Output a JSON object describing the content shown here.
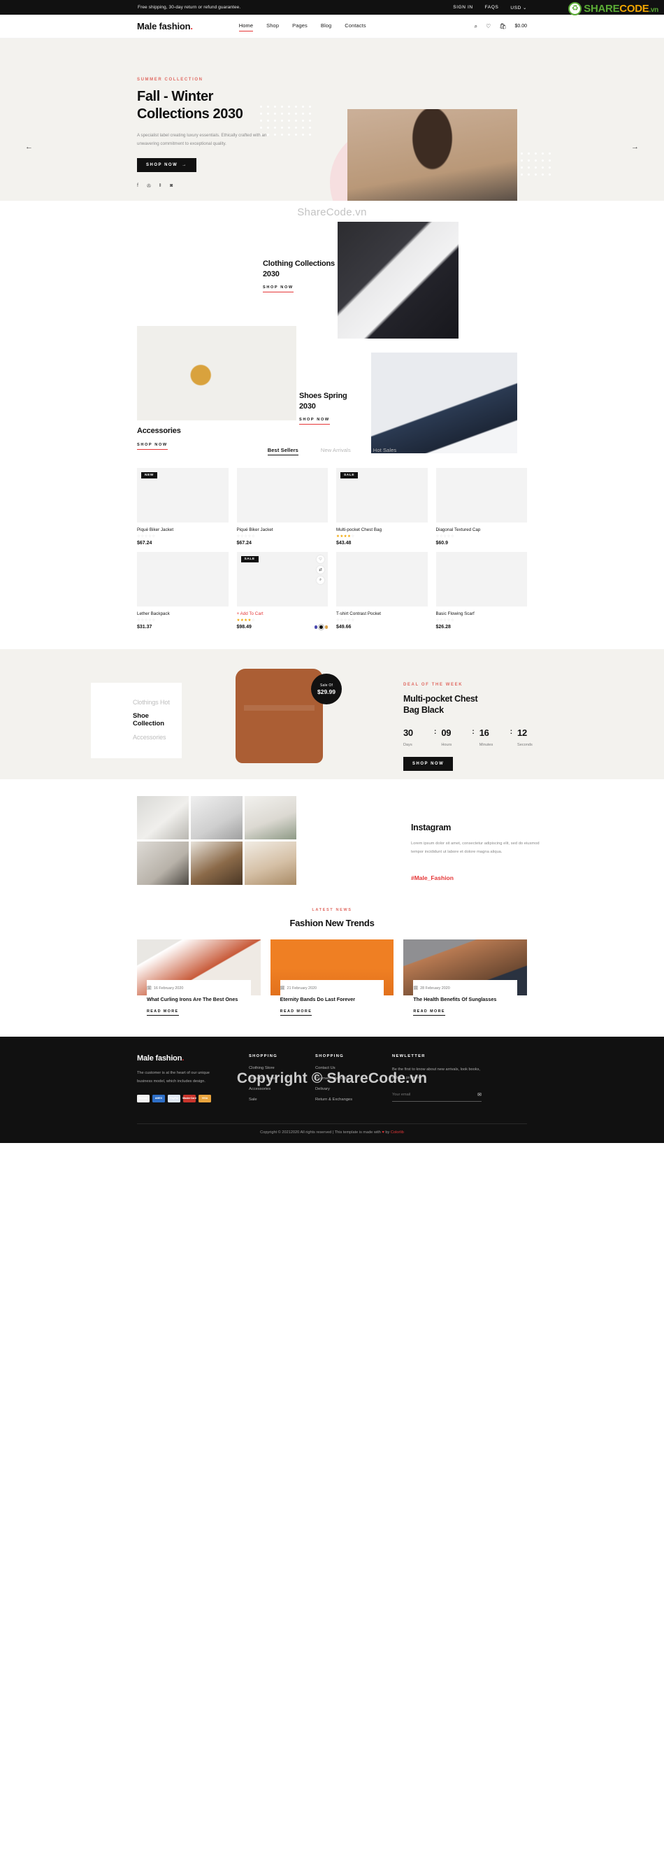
{
  "watermark": {
    "logo_share": "SHARE",
    "logo_code": "CODE",
    "logo_vn": ".vn",
    "center_text": "ShareCode.vn",
    "dark_text": "Copyright © ShareCode.vn"
  },
  "topbar": {
    "message": "Free shipping, 30-day return or refund guarantee.",
    "links": [
      "SIGN IN",
      "FAQS"
    ],
    "currency": "USD",
    "caret": "⌄"
  },
  "header": {
    "logo": "Male fashion",
    "logo_dot": ".",
    "nav": [
      {
        "label": "Home",
        "active": true
      },
      {
        "label": "Shop",
        "active": false
      },
      {
        "label": "Pages",
        "active": false
      },
      {
        "label": "Blog",
        "active": false
      },
      {
        "label": "Contacts",
        "active": false
      }
    ],
    "icons": [
      "search-icon",
      "heart-icon",
      "bag-icon"
    ],
    "cart_total": "$0.00"
  },
  "hero": {
    "eyebrow": "SUMMER COLLECTION",
    "title_line1": "Fall - Winter",
    "title_line2": "Collections 2030",
    "paragraph": "A specialist label creating luxury essentials. Ethically crafted with an unwavering commitment to exceptional quality.",
    "cta": "SHOP NOW",
    "cta_arrow": "→",
    "social": [
      "f",
      "t",
      "p",
      "o"
    ],
    "prev_arrow": "←",
    "next_arrow": "→"
  },
  "collections": [
    {
      "name": "clothing",
      "title": "Clothing Collections 2030",
      "link": "SHOP NOW"
    },
    {
      "name": "accessories",
      "title": "Accessories",
      "link": "SHOP NOW"
    },
    {
      "name": "shoes",
      "title": "Shoes Spring 2030",
      "link": "SHOP NOW"
    }
  ],
  "product_section": {
    "tabs": [
      {
        "label": "Best Sellers",
        "active": true
      },
      {
        "label": "New Arrivals",
        "active": false
      },
      {
        "label": "Hot Sales",
        "active": false
      }
    ],
    "products": [
      {
        "name": "Piqué Biker Jacket",
        "price": "$67.24",
        "rating": 0,
        "badge": "NEW",
        "swatches": []
      },
      {
        "name": "Piqué Biker Jacket",
        "price": "$67.24",
        "rating": 0,
        "badge": "",
        "swatches": []
      },
      {
        "name": "Multi-pocket Chest Bag",
        "price": "$43.48",
        "rating": 4,
        "badge": "SALE",
        "swatches": []
      },
      {
        "name": "Diagonal Textured Cap",
        "price": "$60.9",
        "rating": 0,
        "badge": "",
        "swatches": []
      },
      {
        "name": "Lether Backpack",
        "price": "$31.37",
        "rating": 0,
        "badge": "",
        "swatches": []
      },
      {
        "name": "+ Add To Cart",
        "price": "$98.49",
        "rating": 4,
        "badge": "SALE",
        "swatches": [
          "#4a49b0",
          "#111111",
          "#d9a14a"
        ]
      },
      {
        "name": "T-shirt Contrast Pocket",
        "price": "$49.66",
        "rating": 0,
        "badge": "",
        "swatches": []
      },
      {
        "name": "Basic Flowing Scarf",
        "price": "$26.28",
        "rating": 0,
        "badge": "",
        "swatches": []
      }
    ]
  },
  "deal": {
    "tabs": [
      {
        "label": "Clothings Hot",
        "active": false
      },
      {
        "label": "Shoe Collection",
        "active": true
      },
      {
        "label": "Accessories",
        "active": false
      }
    ],
    "sale_label": "Sale Of",
    "sale_price": "$29.99",
    "eyebrow": "DEAL OF THE WEEK",
    "title_line1": "Multi-pocket Chest",
    "title_line2": "Bag Black",
    "countdown": [
      {
        "value": "30",
        "label": "Days"
      },
      {
        "value": "09",
        "label": "Hours"
      },
      {
        "value": "16",
        "label": "Minutes"
      },
      {
        "value": "12",
        "label": "Seconds"
      }
    ],
    "separator": ":",
    "cta": "SHOP NOW"
  },
  "instagram": {
    "title": "Instagram",
    "text": "Lorem ipsum dolor sit amet, consectetur adipiscing elit, sed do eiusmod tempor incididunt ut labore et dolore magna aliqua.",
    "hashtag": "#Male_Fashion"
  },
  "news": {
    "eyebrow": "LATEST NEWS",
    "title": "Fashion New Trends",
    "items": [
      {
        "date": "16 February 2020",
        "title": "What Curling Irons Are The Best Ones",
        "read": "READ MORE"
      },
      {
        "date": "21 February 2020",
        "title": "Eternity Bands Do Last Forever",
        "read": "READ MORE"
      },
      {
        "date": "28 February 2020",
        "title": "The Health Benefits Of Sunglasses",
        "read": "READ MORE"
      }
    ]
  },
  "footer": {
    "logo": "Male fashion",
    "logo_dot": ".",
    "about": "The customer is at the heart of our unique business model, which includes design.",
    "payment_cards": [
      "Bitcoin",
      "AMEX",
      "PayPal",
      "MasterCard",
      "VISA"
    ],
    "col1_heading": "SHOPPING",
    "col1_links": [
      "Clothing Store",
      "Trending Shoes",
      "Accessories",
      "Sale"
    ],
    "col2_heading": "SHOPPING",
    "col2_links": [
      "Contact Us",
      "Payment Methods",
      "Delivary",
      "Return & Exchanges"
    ],
    "newsletter_heading": "NEWLETTER",
    "newsletter_text": "Be the first to know about new arrivals, look books, sales & promos!",
    "newsletter_placeholder": "Your email",
    "newsletter_icon": "✉",
    "copyright_pre": "Copyright © 20212020 All rights reserved | This template is made with ",
    "copyright_heart": "♥",
    "copyright_mid": " by ",
    "copyright_brand": "Colorlib"
  }
}
